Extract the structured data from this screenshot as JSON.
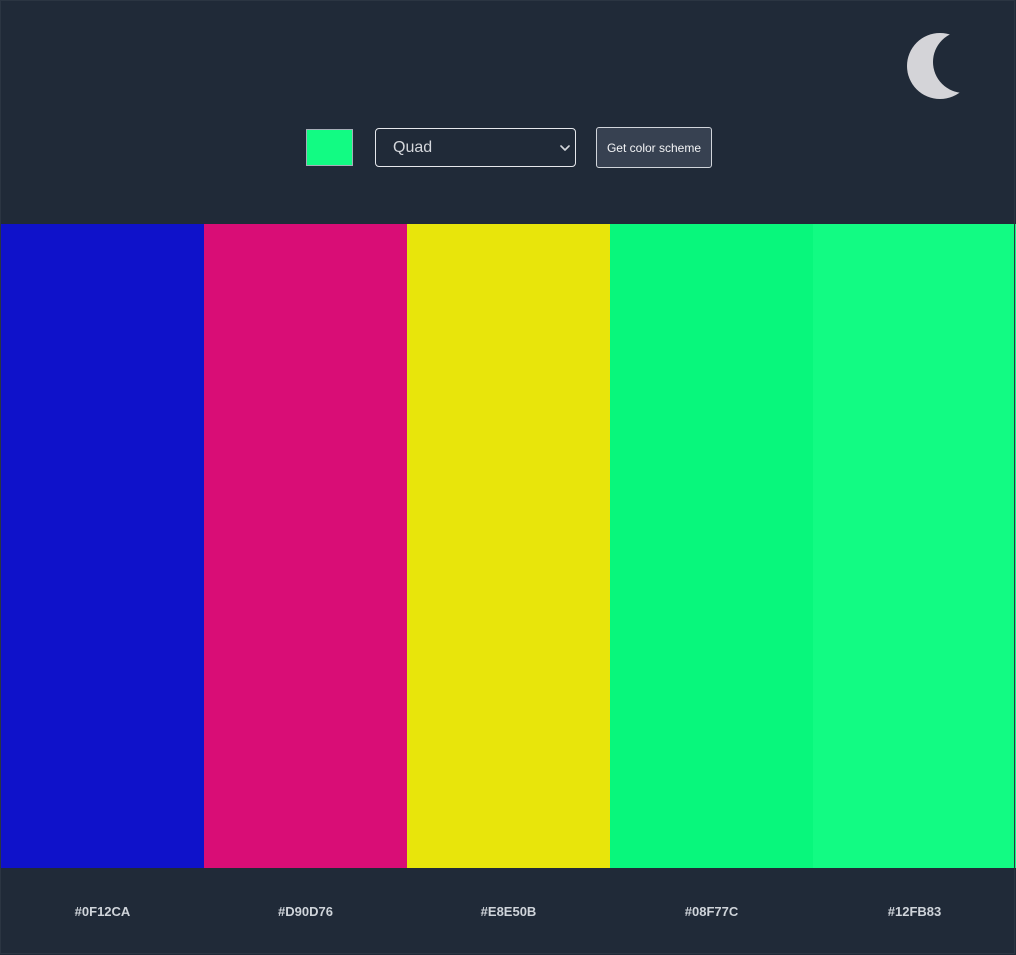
{
  "header": {
    "seed_color": "#12FB83",
    "mode_select": {
      "selected": "Quad"
    },
    "get_button_label": "Get color scheme",
    "theme_icon": "moon-icon"
  },
  "palette": {
    "colors": [
      {
        "hex": "#0F12CA",
        "label": "#0F12CA"
      },
      {
        "hex": "#D90D76",
        "label": "#D90D76"
      },
      {
        "hex": "#E8E50B",
        "label": "#E8E50B"
      },
      {
        "hex": "#08F77C",
        "label": "#08F77C"
      },
      {
        "hex": "#12FB83",
        "label": "#12FB83"
      }
    ]
  },
  "colors": {
    "page_background": "#1f2937",
    "header_background": "#202a38",
    "button_background": "#374151",
    "moon": "#d4d4d8"
  }
}
